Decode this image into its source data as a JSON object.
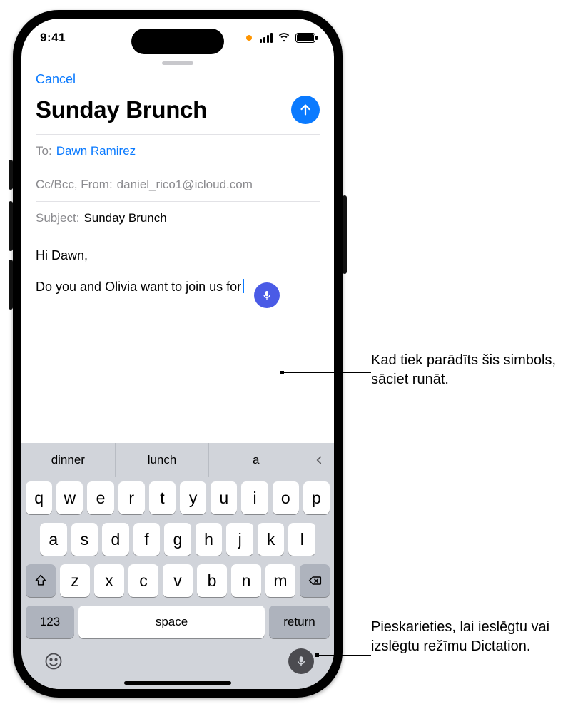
{
  "status": {
    "time": "9:41"
  },
  "compose": {
    "cancel": "Cancel",
    "title": "Sunday Brunch",
    "to_label": "To:",
    "to_value": "Dawn Ramirez",
    "cc_label": "Cc/Bcc, From:",
    "cc_value": "daniel_rico1@icloud.com",
    "subject_label": "Subject:",
    "subject_value": "Sunday Brunch",
    "body_greeting": "Hi Dawn,",
    "body_line": "Do you and Olivia want to join us for"
  },
  "keyboard": {
    "suggestions": [
      "dinner",
      "lunch",
      "a"
    ],
    "row1": [
      "q",
      "w",
      "e",
      "r",
      "t",
      "y",
      "u",
      "i",
      "o",
      "p"
    ],
    "row2": [
      "a",
      "s",
      "d",
      "f",
      "g",
      "h",
      "j",
      "k",
      "l"
    ],
    "row3": [
      "z",
      "x",
      "c",
      "v",
      "b",
      "n",
      "m"
    ],
    "num": "123",
    "space": "space",
    "ret": "return"
  },
  "callouts": {
    "c1": "Kad tiek parādīts šis simbols, sāciet runāt.",
    "c2": "Pieskarieties, lai ieslēgtu vai izslēgtu režīmu Dictation."
  }
}
